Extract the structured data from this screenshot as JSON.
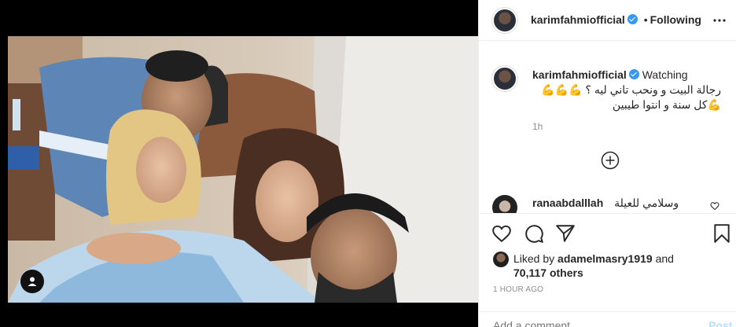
{
  "post": {
    "username": "karimfahmiofficial",
    "follow_separator": "•",
    "follow_label": "Following",
    "caption_user": "karimfahmiofficial",
    "caption_text_start": "Watching",
    "caption_text_ar": "رجالة البيت و ونحب تاني ليه ؟ 💪💪💪💪كل سنة و انتوا طيبين",
    "caption_age": "1h"
  },
  "comment": {
    "user": "ranaabdalllah",
    "text": "وسلامي للعيلة"
  },
  "likes": {
    "prefix": "Liked by",
    "user": "adamelmasry1919",
    "joiner": "and",
    "count": "70,117 others"
  },
  "timestamp": "1 HOUR AGO",
  "add_comment": {
    "placeholder": "Add a comment...",
    "post_label": "Post"
  },
  "colors": {
    "verified": "#3897f0",
    "text": "#262626",
    "muted": "#8e8e8e",
    "post_disabled": "#b2dffc"
  },
  "icons": {
    "more": "more-horizontal-icon",
    "tag": "user-tag-icon",
    "load_more": "plus-circle-icon",
    "like": "heart-icon",
    "comment": "comment-icon",
    "share": "share-icon",
    "save": "bookmark-icon"
  }
}
